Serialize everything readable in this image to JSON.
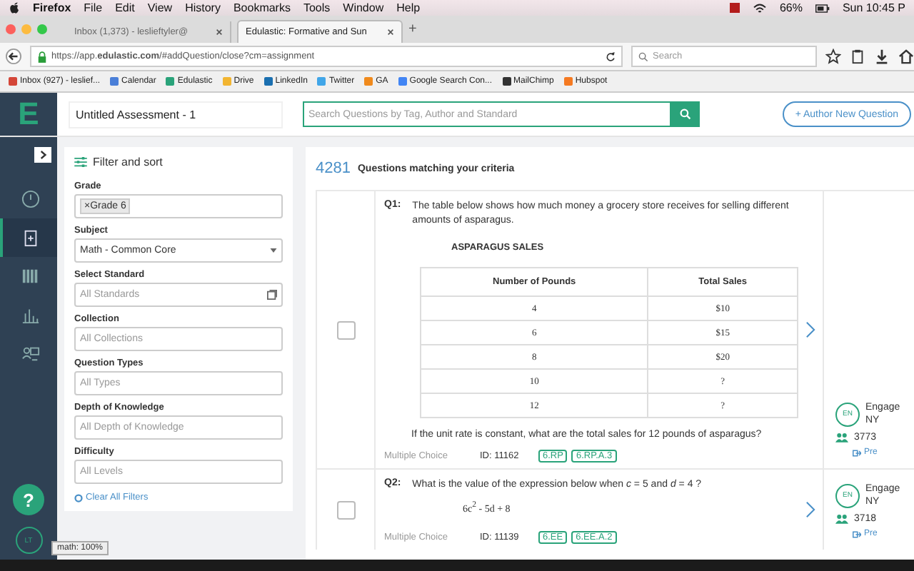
{
  "menubar": {
    "app": "Firefox",
    "menus": [
      "File",
      "Edit",
      "View",
      "History",
      "Bookmarks",
      "Tools",
      "Window",
      "Help"
    ],
    "battery": "66%",
    "clock": "Sun 10:45 P"
  },
  "tabs": [
    {
      "title": "Inbox (1,373) - leslieftyler@",
      "selected": false
    },
    {
      "title": "Edulastic: Formative and Sun",
      "selected": true
    }
  ],
  "new_tab": "+",
  "url_bar": {
    "url": "https://app.**edulastic.com**/#addQuestion/close?cm=assignment",
    "search_placeholder": "Search"
  },
  "bookmarks": [
    {
      "label": "Inbox (927) - leslief...",
      "color": "#d44638"
    },
    {
      "label": "Calendar",
      "color": "#4a7fd8"
    },
    {
      "label": "Edulastic",
      "color": "#2aa37a"
    },
    {
      "label": "Drive",
      "color": "#f2b531"
    },
    {
      "label": "LinkedIn",
      "color": "#1a6fb0"
    },
    {
      "label": "Twitter",
      "color": "#41a6e8"
    },
    {
      "label": "GA",
      "color": "#f08a1c"
    },
    {
      "label": "Google Search Con...",
      "color": "#4285f4"
    },
    {
      "label": "MailChimp",
      "color": "#333333"
    },
    {
      "label": "Hubspot",
      "color": "#f57a22"
    }
  ],
  "header": {
    "logo": "E",
    "title": "Untitled Assessment - 1",
    "search_placeholder": "Search Questions by Tag, Author and Standard",
    "author_button": "+ Author New Question"
  },
  "nav": [
    {
      "kind": "clock",
      "selected": false
    },
    {
      "kind": "clipboard",
      "selected": true
    },
    {
      "kind": "library",
      "selected": false
    },
    {
      "kind": "chart",
      "selected": false
    },
    {
      "kind": "people",
      "selected": false
    }
  ],
  "help": "?",
  "avatar": "LT",
  "filters": {
    "title": "Filter and sort",
    "fields": [
      {
        "label": "Grade",
        "kind": "tags",
        "tags": [
          "×Grade 6"
        ]
      },
      {
        "label": "Subject",
        "kind": "select",
        "value": "Math - Common Core"
      },
      {
        "label": "Select Standard",
        "kind": "standard",
        "placeholder": "All Standards"
      },
      {
        "label": "Collection",
        "kind": "input",
        "placeholder": "All Collections"
      },
      {
        "label": "Question Types",
        "kind": "input",
        "placeholder": "All Types"
      },
      {
        "label": "Depth of Knowledge",
        "kind": "input",
        "placeholder": "All Depth of Knowledge"
      },
      {
        "label": "Difficulty",
        "kind": "input",
        "placeholder": "All Levels"
      }
    ],
    "clear": "Clear All Filters"
  },
  "zoom_tooltip": "math: 100%",
  "results": {
    "count": "4281",
    "label": "Questions matching your criteria"
  },
  "questions": [
    {
      "number": "Q1:",
      "checked": false,
      "text": "The table below shows how much money a grocery store receives for selling different amounts of asparagus.",
      "table": {
        "title": "ASPARAGUS SALES",
        "columns": [
          "Number of Pounds",
          "Total Sales"
        ],
        "rows": [
          [
            "4",
            "$10"
          ],
          [
            "6",
            "$15"
          ],
          [
            "8",
            "$20"
          ],
          [
            "10",
            "?"
          ],
          [
            "12",
            "?"
          ]
        ]
      },
      "follow_up": "If the unit rate is constant, what are the total sales for 12  pounds of asparagus?",
      "type": "Multiple Choice",
      "id": "ID: 11162",
      "standards": [
        "6.RP",
        "6.RP.A.3"
      ],
      "author_badge": "EN",
      "author": "Engage NY",
      "uses": "3773",
      "preview": "Pre"
    },
    {
      "number": "Q2:",
      "checked": false,
      "text": "What is the value of the expression below when *c* = 5 and *d* = 4 ?",
      "expression": "6c$^{2}$ - 5d + 8",
      "type": "Multiple Choice",
      "id": "ID: 11139",
      "standards": [
        "6.EE",
        "6.EE.A.2"
      ],
      "author_badge": "EN",
      "author": "Engage NY",
      "uses": "3718",
      "preview": "Pre"
    }
  ]
}
